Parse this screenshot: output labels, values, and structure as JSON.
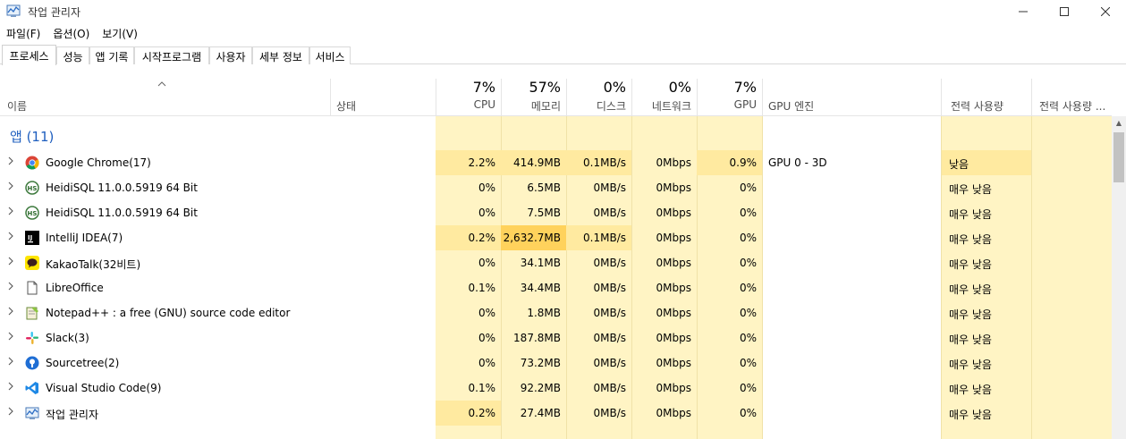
{
  "window": {
    "title": "작업 관리자",
    "controls": {
      "minimize": "—",
      "maximize": "☐",
      "close": "✕"
    }
  },
  "menu": [
    "파일(F)",
    "옵션(O)",
    "보기(V)"
  ],
  "tabs": [
    "프로세스",
    "성능",
    "앱 기록",
    "시작프로그램",
    "사용자",
    "세부 정보",
    "서비스"
  ],
  "active_tab": "프로세스",
  "columns": {
    "name": "이름",
    "status": "상태",
    "cpu": {
      "pct": "7%",
      "label": "CPU"
    },
    "memory": {
      "pct": "57%",
      "label": "메모리"
    },
    "disk": {
      "pct": "0%",
      "label": "디스크"
    },
    "network": {
      "pct": "0%",
      "label": "네트워크"
    },
    "gpu": {
      "pct": "7%",
      "label": "GPU"
    },
    "gpu_engine": "GPU 엔진",
    "power": "전력 사용량",
    "power_trend": "전력 사용량 ..."
  },
  "group_label": "앱 (11)",
  "rows": [
    {
      "name": "Google Chrome(17)",
      "icon": "chrome-icon",
      "cpu": "2.2%",
      "memory": "414.9MB",
      "disk": "0.1MB/s",
      "network": "0Mbps",
      "gpu": "0.9%",
      "gpu_engine": "GPU 0 - 3D",
      "power": "낮음"
    },
    {
      "name": "HeidiSQL 11.0.0.5919 64 Bit",
      "icon": "heidisql-icon",
      "cpu": "0%",
      "memory": "6.5MB",
      "disk": "0MB/s",
      "network": "0Mbps",
      "gpu": "0%",
      "gpu_engine": "",
      "power": "매우 낮음"
    },
    {
      "name": "HeidiSQL 11.0.0.5919 64 Bit",
      "icon": "heidisql-icon",
      "cpu": "0%",
      "memory": "7.5MB",
      "disk": "0MB/s",
      "network": "0Mbps",
      "gpu": "0%",
      "gpu_engine": "",
      "power": "매우 낮음"
    },
    {
      "name": "IntelliJ IDEA(7)",
      "icon": "intellij-icon",
      "cpu": "0.2%",
      "memory": "2,632.7MB",
      "disk": "0.1MB/s",
      "network": "0Mbps",
      "gpu": "0%",
      "gpu_engine": "",
      "power": "매우 낮음"
    },
    {
      "name": "KakaoTalk(32비트)",
      "icon": "kakaotalk-icon",
      "cpu": "0%",
      "memory": "34.1MB",
      "disk": "0MB/s",
      "network": "0Mbps",
      "gpu": "0%",
      "gpu_engine": "",
      "power": "매우 낮음"
    },
    {
      "name": "LibreOffice",
      "icon": "libreoffice-icon",
      "cpu": "0.1%",
      "memory": "34.4MB",
      "disk": "0MB/s",
      "network": "0Mbps",
      "gpu": "0%",
      "gpu_engine": "",
      "power": "매우 낮음"
    },
    {
      "name": "Notepad++ : a free (GNU) source code editor",
      "icon": "notepadpp-icon",
      "cpu": "0%",
      "memory": "1.8MB",
      "disk": "0MB/s",
      "network": "0Mbps",
      "gpu": "0%",
      "gpu_engine": "",
      "power": "매우 낮음"
    },
    {
      "name": "Slack(3)",
      "icon": "slack-icon",
      "cpu": "0%",
      "memory": "187.8MB",
      "disk": "0MB/s",
      "network": "0Mbps",
      "gpu": "0%",
      "gpu_engine": "",
      "power": "매우 낮음"
    },
    {
      "name": "Sourcetree(2)",
      "icon": "sourcetree-icon",
      "cpu": "0%",
      "memory": "73.2MB",
      "disk": "0MB/s",
      "network": "0Mbps",
      "gpu": "0%",
      "gpu_engine": "",
      "power": "매우 낮음"
    },
    {
      "name": "Visual Studio Code(9)",
      "icon": "vscode-icon",
      "cpu": "0.1%",
      "memory": "92.2MB",
      "disk": "0MB/s",
      "network": "0Mbps",
      "gpu": "0%",
      "gpu_engine": "",
      "power": "매우 낮음"
    },
    {
      "name": "작업 관리자",
      "icon": "task-manager-icon",
      "cpu": "0.2%",
      "memory": "27.4MB",
      "disk": "0MB/s",
      "network": "0Mbps",
      "gpu": "0%",
      "gpu_engine": "",
      "power": "매우 낮음"
    }
  ],
  "colors": {
    "heat_light": "#fff4c4",
    "heat_mid": "#ffeaa0",
    "heat_high": "#ffd25c",
    "group_blue": "#1f5fbf"
  }
}
